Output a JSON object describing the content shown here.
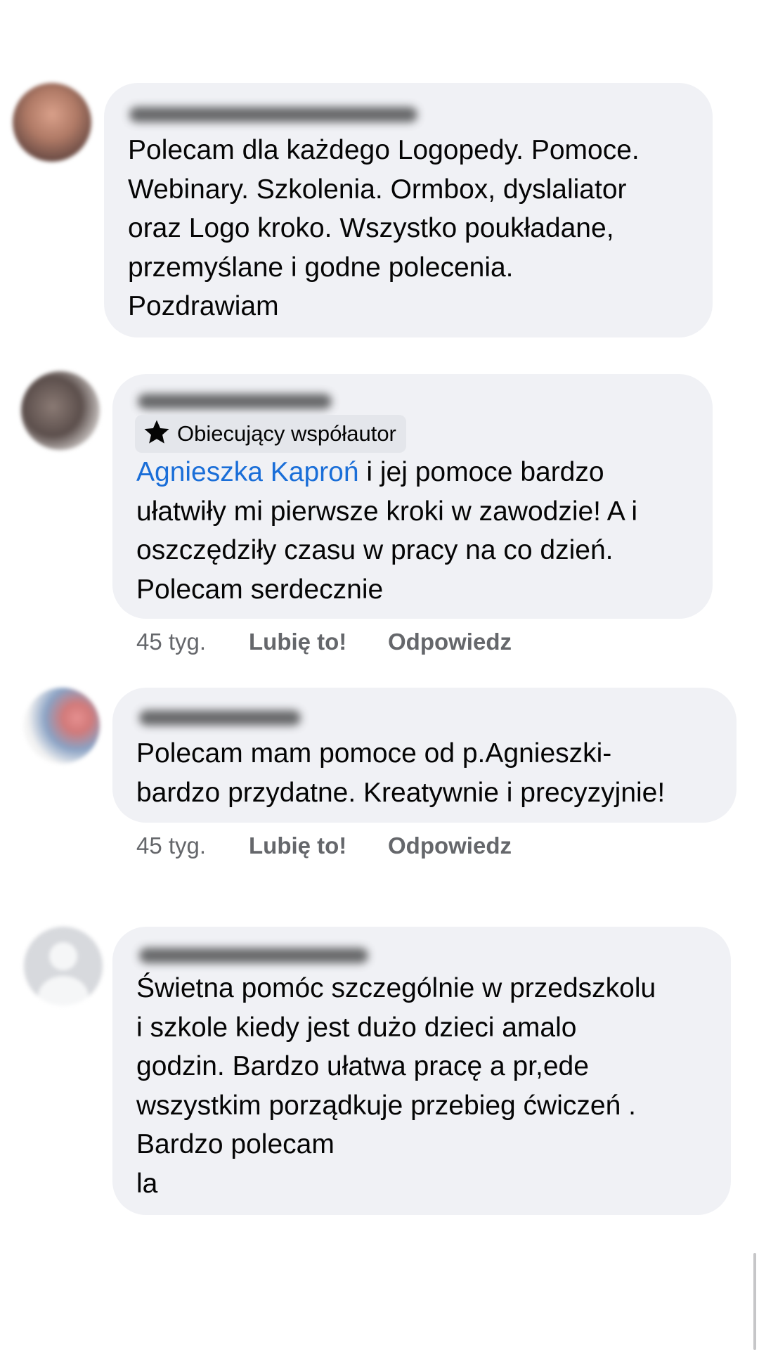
{
  "comments": [
    {
      "text": "Polecam dla każdego Logopedy. Pomoce.\nWebinary. Szkolenia. Ormbox, dyslaliator\noraz Logo kroko. Wszystko poukładane,\nprzemyślane i godne polecenia.\nPozdrawiam"
    },
    {
      "badge": {
        "icon": "star-icon",
        "label": "Obiecujący współautor"
      },
      "mention": "Agnieszka Kaproń",
      "text": " i jej pomoce bardzo\nułatwiły mi pierwsze kroki w zawodzie! A i\noszczędziły czasu w pracy na co dzień.\nPolecam serdecznie",
      "actions": {
        "time": "45 tyg.",
        "like": "Lubię to!",
        "reply": "Odpowiedz"
      }
    },
    {
      "text": "Polecam mam pomoce od p.Agnieszki-\nbardzo przydatne. Kreatywnie i precyzyjnie!",
      "actions": {
        "time": "45 tyg.",
        "like": "Lubię to!",
        "reply": "Odpowiedz"
      }
    },
    {
      "text": "Świetna pomóc szczególnie w przedszkolu\ni szkole kiedy jest dużo dzieci amalo\ngodzin. Bardzo ułatwa pracę a pr,ede\nwszystkim porządkuje przebieg ćwiczeń .\nBardzo polecam\nla"
    }
  ],
  "colors": {
    "bubble": "#f0f1f5",
    "mention": "#1a6ed8",
    "secondary_text": "#65676b"
  }
}
